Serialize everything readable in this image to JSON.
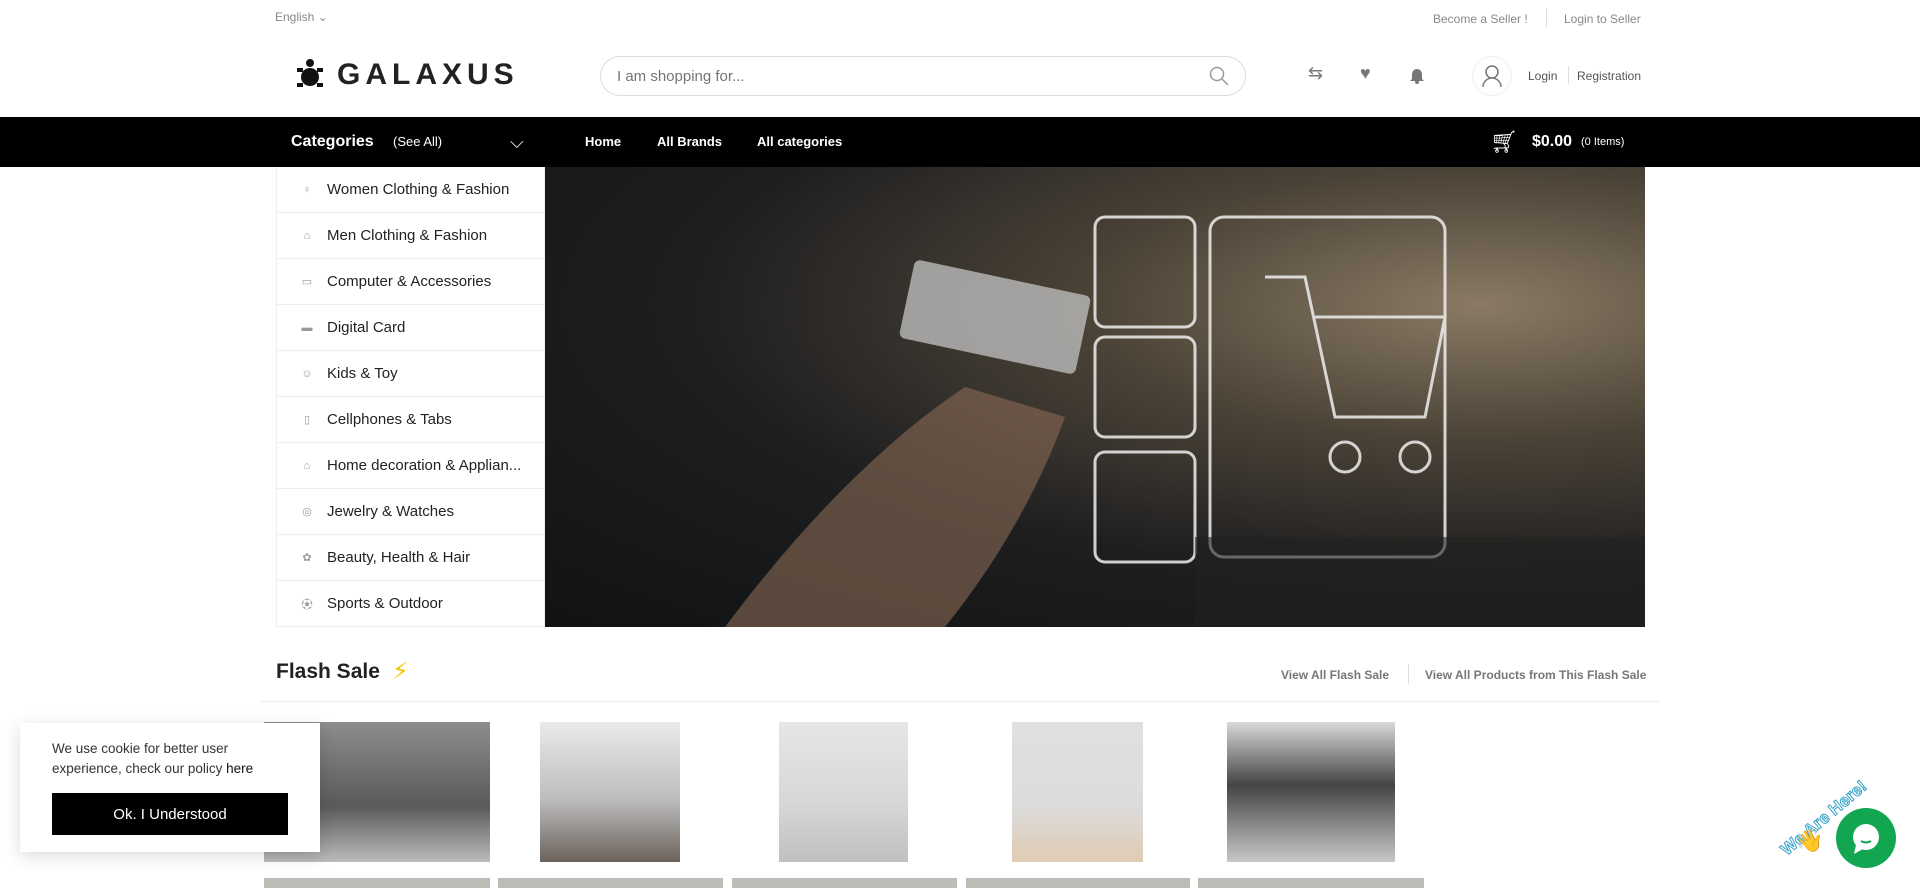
{
  "topbar": {
    "language": "English",
    "become_seller": "Become a Seller !",
    "login_seller": "Login to Seller"
  },
  "header": {
    "logo": "GALAXUS",
    "search_placeholder": "I am shopping for...",
    "login": "Login",
    "registration": "Registration"
  },
  "nav": {
    "categories": "Categories",
    "see_all": "(See All)",
    "links": [
      "Home",
      "All Brands",
      "All categories"
    ],
    "cart_total": "$0.00",
    "cart_items": "(0 Items)"
  },
  "sidebar": {
    "items": [
      {
        "label": "Women Clothing & Fashion",
        "icon": "dress-icon"
      },
      {
        "label": "Men Clothing & Fashion",
        "icon": "shirt-icon"
      },
      {
        "label": "Computer & Accessories",
        "icon": "monitor-icon"
      },
      {
        "label": "Digital Card",
        "icon": "card-icon"
      },
      {
        "label": "Kids & Toy",
        "icon": "toy-icon"
      },
      {
        "label": "Cellphones & Tabs",
        "icon": "phone-icon"
      },
      {
        "label": "Home decoration & Applian...",
        "icon": "home-icon"
      },
      {
        "label": "Jewelry & Watches",
        "icon": "watch-icon"
      },
      {
        "label": "Beauty, Health & Hair",
        "icon": "beauty-icon"
      },
      {
        "label": "Sports & Outdoor",
        "icon": "sports-icon"
      }
    ]
  },
  "flash": {
    "title": "Flash Sale",
    "view_all": "View All Flash Sale",
    "view_products": "View All Products from This Flash Sale"
  },
  "cookie": {
    "text": "We use cookie for better user experience, check our policy",
    "link": "here",
    "button": "Ok. I Understood"
  },
  "chat": {
    "label": "We Are Here!"
  },
  "colors": {
    "accent": "#000000",
    "flash": "#f5c400",
    "chat": "#13a650"
  }
}
